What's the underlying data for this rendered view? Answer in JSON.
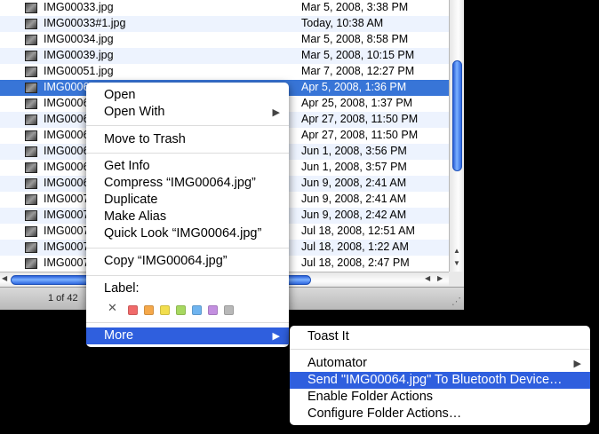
{
  "finder": {
    "files": [
      {
        "name": "IMG00033.jpg",
        "date": "Mar 5, 2008, 3:38 PM"
      },
      {
        "name": "IMG00033#1.jpg",
        "date": "Today, 10:38 AM"
      },
      {
        "name": "IMG00034.jpg",
        "date": "Mar 5, 2008, 8:58 PM"
      },
      {
        "name": "IMG00039.jpg",
        "date": "Mar 5, 2008, 10:15 PM"
      },
      {
        "name": "IMG00051.jpg",
        "date": "Mar 7, 2008, 12:27 PM"
      },
      {
        "name": "IMG0006",
        "date": "Apr 5, 2008, 1:36 PM"
      },
      {
        "name": "IMG0006",
        "date": "Apr 25, 2008, 1:37 PM"
      },
      {
        "name": "IMG0006",
        "date": "Apr 27, 2008, 11:50 PM"
      },
      {
        "name": "IMG0006",
        "date": "Apr 27, 2008, 11:50 PM"
      },
      {
        "name": "IMG0006",
        "date": "Jun 1, 2008, 3:56 PM"
      },
      {
        "name": "IMG0006",
        "date": "Jun 1, 2008, 3:57 PM"
      },
      {
        "name": "IMG0006",
        "date": "Jun 9, 2008, 2:41 AM"
      },
      {
        "name": "IMG0007",
        "date": "Jun 9, 2008, 2:41 AM"
      },
      {
        "name": "IMG0007",
        "date": "Jun 9, 2008, 2:42 AM"
      },
      {
        "name": "IMG0007",
        "date": "Jul 18, 2008, 12:51 AM"
      },
      {
        "name": "IMG0007",
        "date": "Jul 18, 2008, 1:22 AM"
      },
      {
        "name": "IMG0007",
        "date": "Jul 18, 2008, 2:47 PM"
      }
    ],
    "selected_index": 5,
    "status": "1 of 42"
  },
  "context_menu": {
    "open": "Open",
    "open_with": "Open With",
    "move_to_trash": "Move to Trash",
    "get_info": "Get Info",
    "compress": "Compress “IMG00064.jpg”",
    "duplicate": "Duplicate",
    "make_alias": "Make Alias",
    "quick_look": "Quick Look “IMG00064.jpg”",
    "copy": "Copy “IMG00064.jpg”",
    "label_title": "Label:",
    "label_clear": "✕",
    "label_colors": [
      "#f06a6a",
      "#f5a84a",
      "#f2de4e",
      "#a7d860",
      "#6fb4ef",
      "#c38fe0",
      "#b8b8b8"
    ],
    "more": "More"
  },
  "submenu": {
    "toast_it": "Toast It",
    "automator": "Automator",
    "send_bluetooth": "Send \"IMG00064.jpg\" To Bluetooth Device…",
    "enable_folder_actions": "Enable Folder Actions",
    "configure_folder_actions": "Configure Folder Actions…"
  }
}
